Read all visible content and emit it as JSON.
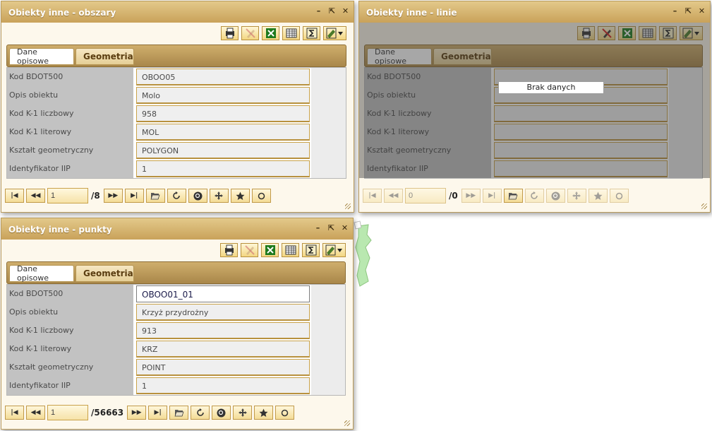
{
  "panels": [
    {
      "title": "Obiekty inne - obszary",
      "tabs": [
        "Dane opisowe",
        "Geometria"
      ],
      "rows": [
        {
          "label": "Kod BDOT500",
          "value": "OBOO05"
        },
        {
          "label": "Opis obiektu",
          "value": "Molo"
        },
        {
          "label": "Kod K-1 liczbowy",
          "value": "958"
        },
        {
          "label": "Kod K-1 literowy",
          "value": "MOL"
        },
        {
          "label": "Kształt geometryczny",
          "value": "POLYGON"
        },
        {
          "label": "Identyfikator IIP",
          "value": "1"
        }
      ],
      "page": "1",
      "total": "/8"
    },
    {
      "title": "Obiekty inne - linie",
      "tabs": [
        "Dane opisowe",
        "Geometria"
      ],
      "rows": [
        {
          "label": "Kod BDOT500",
          "value": ""
        },
        {
          "label": "Opis obiektu",
          "value": ""
        },
        {
          "label": "Kod K-1 liczbowy",
          "value": ""
        },
        {
          "label": "Kod K-1 literowy",
          "value": ""
        },
        {
          "label": "Kształt geometryczny",
          "value": ""
        },
        {
          "label": "Identyfikator IIP",
          "value": ""
        }
      ],
      "nodata": "Brak danych",
      "page": "0",
      "total": "/0"
    },
    {
      "title": "Obiekty inne - punkty",
      "tabs": [
        "Dane opisowe",
        "Geometria"
      ],
      "rows": [
        {
          "label": "Kod BDOT500",
          "value": "OBOO01_01"
        },
        {
          "label": "Opis obiektu",
          "value": "Krzyż przydrożny"
        },
        {
          "label": "Kod K-1 liczbowy",
          "value": "913"
        },
        {
          "label": "Kod K-1 literowy",
          "value": "KRZ"
        },
        {
          "label": "Kształt geometryczny",
          "value": "POINT"
        },
        {
          "label": "Identyfikator IIP",
          "value": "1"
        }
      ],
      "page": "1",
      "total": "/56663"
    }
  ],
  "window_buttons": {
    "minimize": "–",
    "restore": "⇱",
    "close": "✕"
  },
  "nav_glyphs": {
    "first": "|◀",
    "prev": "◀◀",
    "next": "▶▶",
    "last": "▶|"
  },
  "colors": {
    "accent": "#c9a25a",
    "excel": "#1e7a1e",
    "no_draw": "#d02020"
  },
  "icons": [
    "print-icon",
    "draw-disabled-icon",
    "excel-icon",
    "table-icon",
    "sum-icon",
    "edit-menu-icon",
    "first-page-icon",
    "prev-page-icon",
    "next-page-icon",
    "last-page-icon",
    "open-folder-icon",
    "refresh-icon",
    "zoom-icon",
    "move-icon",
    "star-icon",
    "circle-icon"
  ]
}
